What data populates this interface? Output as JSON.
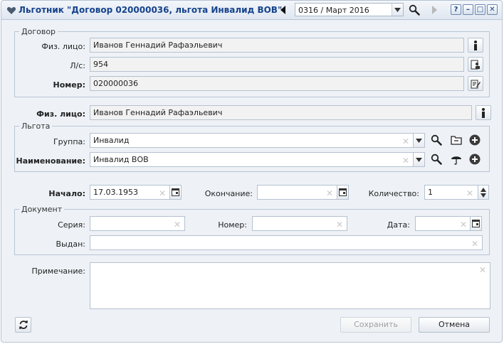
{
  "window": {
    "title": "Льготник \"Договор 020000036, льгота Инвалид ВОВ\"",
    "period": "0316 / Март 2016",
    "help_label": "?",
    "minimize_label": "–",
    "maximize_label": "□",
    "close_label": "✕"
  },
  "contract": {
    "legend": "Договор",
    "person_label": "Физ. лицо:",
    "person_value": "Иванов Геннадий Рафаэльевич",
    "account_label": "Л/с:",
    "account_value": "954",
    "number_label": "Номер:",
    "number_value": "020000036"
  },
  "person": {
    "label": "Физ. лицо:",
    "value": "Иванов Геннадий Рафаэльевич"
  },
  "benefit": {
    "legend": "Льгота",
    "group_label": "Группа:",
    "group_value": "Инвалид",
    "name_label": "Наименование:",
    "name_value": "Инвалид ВОВ"
  },
  "period": {
    "start_label": "Начало:",
    "start_value": "17.03.1953",
    "end_label": "Окончание:",
    "end_value": "",
    "count_label": "Количество:",
    "count_value": "1"
  },
  "document": {
    "legend": "Документ",
    "series_label": "Серия:",
    "series_value": "",
    "number_label": "Номер:",
    "number_value": "",
    "date_label": "Дата:",
    "date_value": "",
    "issued_label": "Выдан:",
    "issued_value": ""
  },
  "note": {
    "label": "Примечание:",
    "value": ""
  },
  "footer": {
    "save_label": "Сохранить",
    "cancel_label": "Отмена"
  }
}
